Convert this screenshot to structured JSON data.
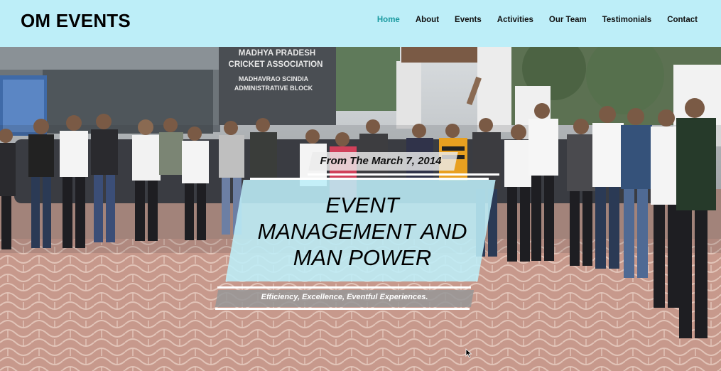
{
  "brand": {
    "name": "OM EVENTS"
  },
  "nav": {
    "items": [
      {
        "label": "Home",
        "active": true
      },
      {
        "label": "About",
        "active": false
      },
      {
        "label": "Events",
        "active": false
      },
      {
        "label": "Activities",
        "active": false
      },
      {
        "label": "Our Team",
        "active": false
      },
      {
        "label": "Testimonials",
        "active": false
      },
      {
        "label": "Contact",
        "active": false
      }
    ]
  },
  "hero": {
    "building_sign": [
      "MADHYA PRADESH",
      "CRICKET ASSOCIATION",
      "MADHAVRAO SCINDIA",
      "ADMINISTRATIVE BLOCK"
    ],
    "date_line": "From The March 7, 2014",
    "title_lines": [
      "EVENT",
      "MANAGEMENT AND",
      "MAN POWER"
    ],
    "tagline": "Efficiency, Excellence, Eventful Experiences."
  },
  "colors": {
    "header_bg": "#bdeef8",
    "nav_active": "#1a9aa0",
    "title_panel": "#bdeef8",
    "tag_panel": "#969696"
  }
}
